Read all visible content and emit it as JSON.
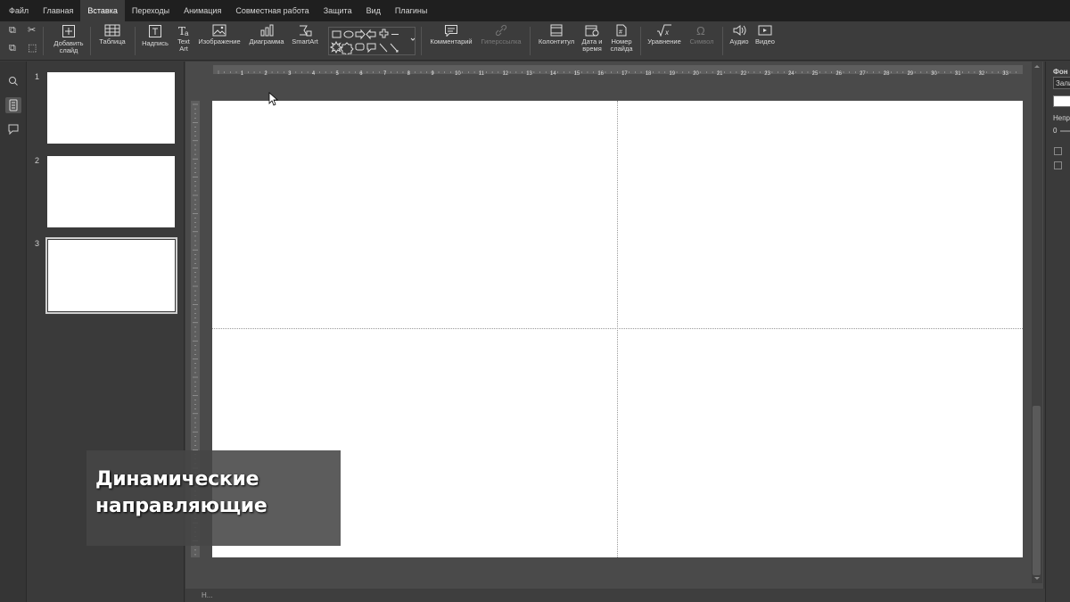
{
  "menu": {
    "tabs": [
      "Файл",
      "Главная",
      "Вставка",
      "Переходы",
      "Анимация",
      "Совместная работа",
      "Защита",
      "Вид",
      "Плагины"
    ],
    "active": "Вставка"
  },
  "toolbar": {
    "add_slide": "Добавить слайд",
    "table": "Таблица",
    "textbox": "Надпись",
    "textart": "Text Art",
    "image": "Изображение",
    "chart": "Диаграмма",
    "smartart": "SmartArt",
    "comment": "Комментарий",
    "hyperlink": "Гиперссылка",
    "header_footer": "Колонтитул",
    "date_time": "Дата и время",
    "slide_number": "Номер слайда",
    "equation": "Уравнение",
    "symbol": "Символ",
    "audio": "Аудио",
    "video": "Видео"
  },
  "slides": [
    {
      "number": "1"
    },
    {
      "number": "2"
    },
    {
      "number": "3",
      "selected": true
    }
  ],
  "ruler_labels": [
    "1",
    "2",
    "3",
    "4",
    "5",
    "6",
    "7",
    "8",
    "9",
    "10",
    "11",
    "12",
    "13",
    "14",
    "15",
    "16",
    "17",
    "18",
    "19",
    "20",
    "21",
    "22",
    "23",
    "24",
    "25",
    "26",
    "27",
    "28",
    "29",
    "30",
    "31",
    "32",
    "33"
  ],
  "right_panel": {
    "background_label": "Фон",
    "fill_value": "Зали",
    "opacity_label": "Непр",
    "opacity_value": "0"
  },
  "status_text": "Н...",
  "caption": "Динамические направляющие",
  "colors": {
    "menubar": "#1f1f1f",
    "toolbar": "#3c3c3c",
    "workspace": "#4a4a4a",
    "slide": "#ffffff"
  }
}
